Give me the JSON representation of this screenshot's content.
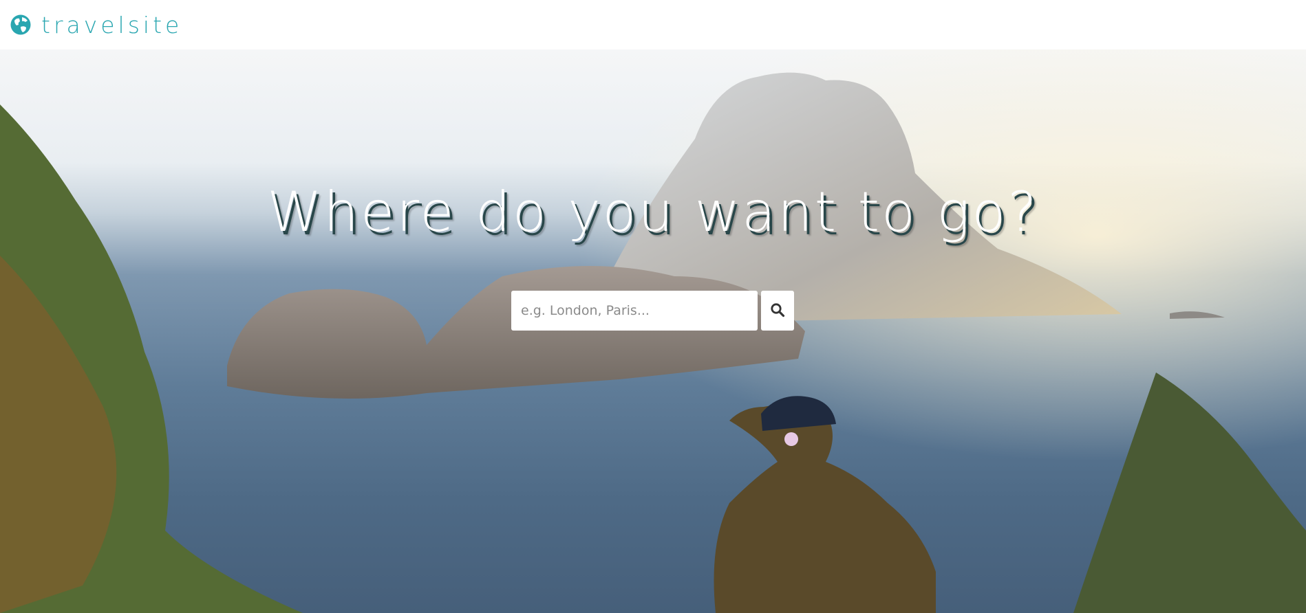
{
  "brand": {
    "name": "travelsite",
    "icon": "globe-icon",
    "color": "#29a6b0"
  },
  "hero": {
    "title": "Where do you want to go?"
  },
  "search": {
    "placeholder": "e.g. London, Paris...",
    "value": "",
    "button_icon": "search-icon"
  }
}
